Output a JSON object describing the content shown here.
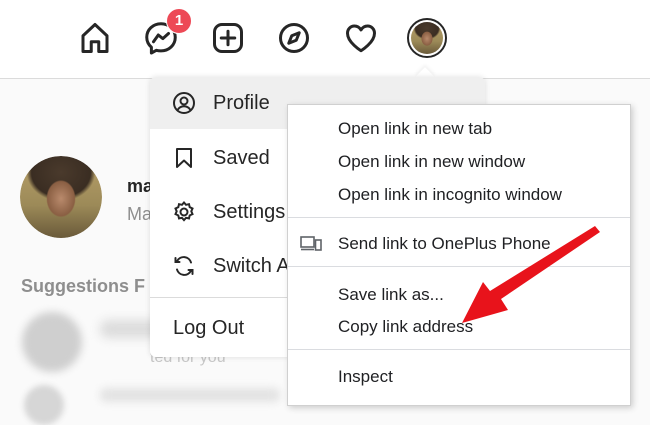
{
  "nav": {
    "icons": [
      "home-icon",
      "messenger-icon",
      "new-post-icon",
      "explore-icon",
      "activity-heart-icon",
      "profile-avatar"
    ],
    "messenger_badge": "1"
  },
  "profile": {
    "username": "ma",
    "name_partial": "Ma"
  },
  "sidebar": {
    "suggestions_label": "Suggestions F",
    "suggested_text": "ted for you"
  },
  "account_menu": {
    "items": [
      {
        "label": "Profile",
        "icon": "user-circle-icon"
      },
      {
        "label": "Saved",
        "icon": "bookmark-icon"
      },
      {
        "label": "Settings",
        "icon": "gear-icon"
      },
      {
        "label": "Switch A",
        "icon": "switch-account-icon"
      }
    ],
    "logout_label": "Log Out"
  },
  "context_menu": {
    "items": [
      "Open link in new tab",
      "Open link in new window",
      "Open link in incognito window",
      "Send link to OnePlus Phone",
      "Save link as...",
      "Copy link address",
      "Inspect"
    ]
  },
  "colors": {
    "badge": "#ed4956",
    "annotation_arrow": "#e8131b"
  }
}
